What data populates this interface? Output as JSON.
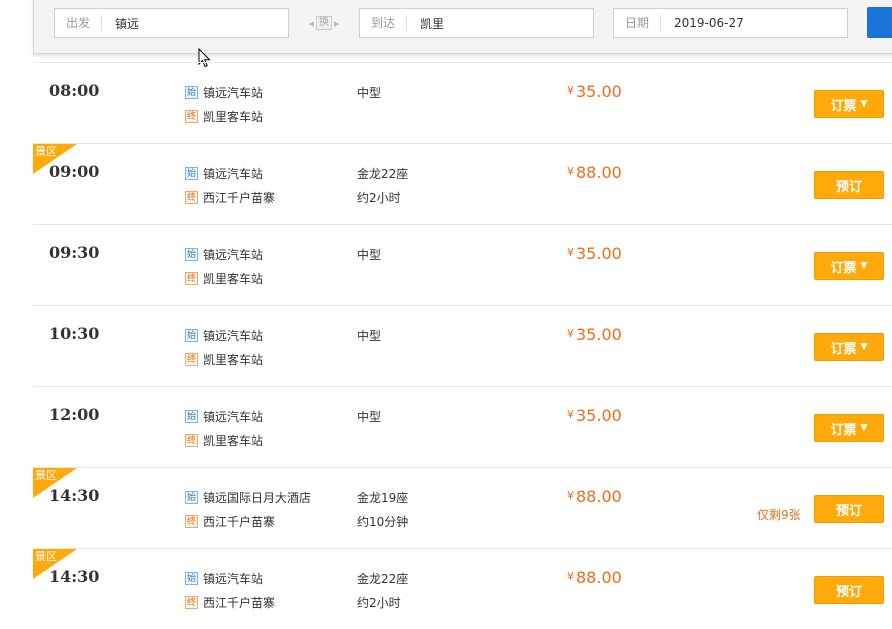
{
  "search": {
    "from_label": "出发",
    "from_value": "镇远",
    "swap_label": "换",
    "to_label": "到达",
    "to_value": "凯里",
    "date_label": "日期",
    "date_value": "2019-06-27"
  },
  "colors": {
    "accent_blue": "#1a73d6",
    "price_orange": "#f26c1a",
    "button_orange": "#ffa90a"
  },
  "badges": {
    "depart": "始",
    "arrive": "终"
  },
  "currency": "¥",
  "trips": [
    {
      "time": "08:00",
      "tag": "",
      "from": "镇远汽车站",
      "to": "凯里客车站",
      "info1": "中型",
      "info2": "",
      "price": "35.00",
      "remaining": "",
      "button": "订票",
      "button_caret": "▼"
    },
    {
      "time": "09:00",
      "tag": "景区",
      "from": "镇远汽车站",
      "to": "西江千户苗寨",
      "info1": "金龙22座",
      "info2": "约2小时",
      "price": "88.00",
      "remaining": "",
      "button": "预订",
      "button_caret": ""
    },
    {
      "time": "09:30",
      "tag": "",
      "from": "镇远汽车站",
      "to": "凯里客车站",
      "info1": "中型",
      "info2": "",
      "price": "35.00",
      "remaining": "",
      "button": "订票",
      "button_caret": "▼"
    },
    {
      "time": "10:30",
      "tag": "",
      "from": "镇远汽车站",
      "to": "凯里客车站",
      "info1": "中型",
      "info2": "",
      "price": "35.00",
      "remaining": "",
      "button": "订票",
      "button_caret": "▼"
    },
    {
      "time": "12:00",
      "tag": "",
      "from": "镇远汽车站",
      "to": "凯里客车站",
      "info1": "中型",
      "info2": "",
      "price": "35.00",
      "remaining": "",
      "button": "订票",
      "button_caret": "▼"
    },
    {
      "time": "14:30",
      "tag": "景区",
      "from": "镇远国际日月大酒店",
      "to": "西江千户苗寨",
      "info1": "金龙19座",
      "info2": "约10分钟",
      "price": "88.00",
      "remaining": "仅剩9张",
      "button": "预订",
      "button_caret": ""
    },
    {
      "time": "14:30",
      "tag": "景区",
      "from": "镇远汽车站",
      "to": "西江千户苗寨",
      "info1": "金龙22座",
      "info2": "约2小时",
      "price": "88.00",
      "remaining": "",
      "button": "预订",
      "button_caret": ""
    }
  ]
}
